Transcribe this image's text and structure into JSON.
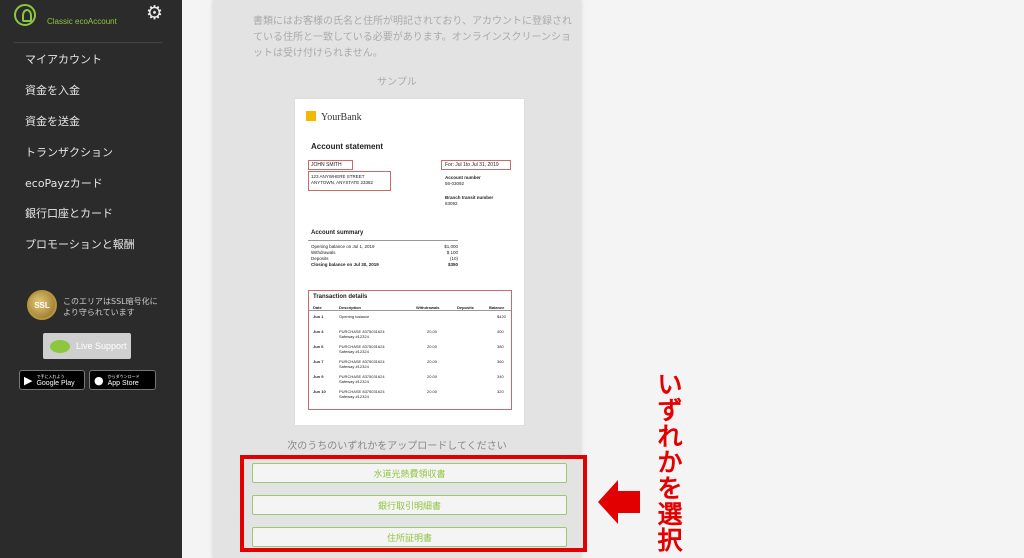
{
  "sidebar": {
    "brand": "Classic ecoAccount",
    "nav": [
      "マイアカウント",
      "資金を入金",
      "資金を送金",
      "トランザクション",
      "ecoPayzカード",
      "銀行口座とカード",
      "プロモーションと報酬"
    ],
    "ssl_badge": "SSL",
    "ssl_text": "このエリアはSSL暗号化により守られています",
    "live_support": "Live Support",
    "google_play": {
      "sub": "で手に入れよう",
      "main": "Google Play"
    },
    "app_store": {
      "sub": "からダウンロード",
      "main": "App Store"
    }
  },
  "main": {
    "instructions": "書類にはお客様の氏名と住所が明記されており、アカウントに登録されている住所と一致している必要があります。オンラインスクリーンショットは受け付けられません。",
    "sample_label": "サンプル",
    "upload_prompt": "次のうちのいずれかをアップロードしてください",
    "options": [
      "水道光熱費領収書",
      "銀行取引明細書",
      "住所証明書"
    ]
  },
  "sample_doc": {
    "bank_name": "YourBank",
    "title": "Account statement",
    "name": "JOHN SMITH",
    "address_line1": "123 ANYWHERE STREET",
    "address_line2": "ANYTOWN, ANYSTATE 23382",
    "period": "For: Jul 1to Jul 31, 2019",
    "account_number_label": "Account number",
    "account_number": "56-03092",
    "branch_label": "Branch transit number",
    "branch_number": "83092",
    "summary_title": "Account summary",
    "summary": [
      {
        "label": "Opening balance on Jul 1, 2019",
        "value": "$1,000"
      },
      {
        "label": "Withdrawals",
        "value": "$ 100"
      },
      {
        "label": "Deposits",
        "value": "(10)"
      },
      {
        "label": "Closing balance on Jul 30, 2019",
        "value": "$350"
      }
    ],
    "tx_title": "Transaction details",
    "tx_headers": [
      "Date",
      "Description",
      "Withdrawals",
      "Deposits",
      "Balance"
    ],
    "transactions": [
      {
        "date": "Jun 1",
        "desc1": "Opening balance",
        "desc2": "",
        "withdrawal": "",
        "balance": "$420"
      },
      {
        "date": "Jun 4",
        "desc1": "PURCHASE 8375031624",
        "desc2": "Safeway #12324",
        "withdrawal": "20.00",
        "balance": "400"
      },
      {
        "date": "Jun 6",
        "desc1": "PURCHASE 8375031624",
        "desc2": "Safeway #12324",
        "withdrawal": "20.00",
        "balance": "380"
      },
      {
        "date": "Jun 7",
        "desc1": "PURCHASE 8375031624",
        "desc2": "Safeway #12324",
        "withdrawal": "20.00",
        "balance": "360"
      },
      {
        "date": "Jun 9",
        "desc1": "PURCHASE 8375031624",
        "desc2": "Safeway #12324",
        "withdrawal": "20.00",
        "balance": "340"
      },
      {
        "date": "Jun 10",
        "desc1": "PURCHASE 8375031624",
        "desc2": "Safeway #12324",
        "withdrawal": "20.00",
        "balance": "320"
      }
    ]
  },
  "annotation": {
    "caption": "いずれかを選択",
    "color": "#e30000"
  },
  "colors": {
    "accent": "#8dc63f",
    "sidebar_bg": "#2b2b2b"
  }
}
